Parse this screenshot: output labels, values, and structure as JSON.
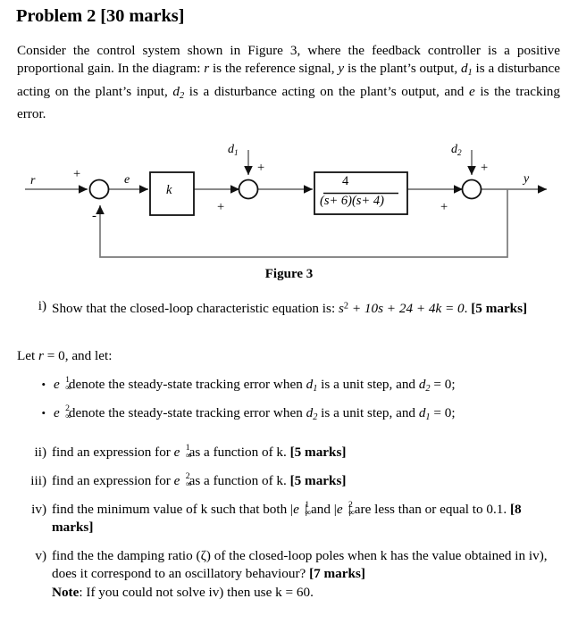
{
  "document": {
    "title": "Problem 2 [30 marks]",
    "intro": {
      "part1": "Consider the control system shown in Figure 3, where the feedback controller is a positive proportional gain.  In the diagram: ",
      "r": "r",
      "part2": " is the reference signal, ",
      "y": "y",
      "part3": " is the plant’s output, ",
      "d1": "d",
      "d1_sub": "1",
      "part4": " is a disturbance acting on the plant’s input, ",
      "d2": "d",
      "d2_sub": "2",
      "part5": " is a disturbance acting on the plant’s output, and ",
      "e": "e",
      "part6": " is the tracking error."
    },
    "figure": {
      "caption": "Figure 3",
      "labels": {
        "input": "r",
        "error": "e",
        "output": "y",
        "disturbance1": "d",
        "disturbance1_sub": "1",
        "disturbance2": "d",
        "disturbance2_sub": "2",
        "controller": "k",
        "plant_numerator": "4",
        "plant_denominator": "(s+ 6)(s+ 4)",
        "sign_plus": "+",
        "sign_minus": "-"
      }
    },
    "items": [
      {
        "marker": "i)",
        "text_before": "Show that the closed-loop characteristic equation is: ",
        "equation": "s",
        "equation_sup": "2",
        "equation_rest": " + 10s + 24 + 4k = 0",
        "text_after": ". ",
        "marks": "[5 marks]"
      },
      {
        "marker": "ii)",
        "text_before": "find an expression for ",
        "symbol_base": "e",
        "symbol_sup": "1",
        "symbol_sub": "∞",
        "text_after": " as a function of k. ",
        "marks": "[5 marks]"
      },
      {
        "marker": "iii)",
        "text_before": "find an expression for ",
        "symbol_base": "e",
        "symbol_sup": "2",
        "symbol_sub": "∞",
        "text_after": " as a function of k. ",
        "marks": "[5 marks]"
      },
      {
        "marker": "iv)",
        "text_before": "find the minimum value of k such that both ",
        "abs1_base": "e",
        "abs1_sup": "1",
        "abs1_sub": "∞",
        "text_mid": " and ",
        "abs2_base": "e",
        "abs2_sup": "2",
        "abs2_sub": "∞",
        "text_after": " are less than or equal to 0.1. ",
        "marks": "[8 marks]"
      },
      {
        "marker": "v)",
        "text_before": "find the the damping ratio (ζ) of the closed-loop poles when k has the value obtained in iv), does it correspond to an oscillatory behaviour? ",
        "marks": "[7 marks]",
        "note_label": "Note",
        "note_text": ": If you could not solve iv) then use k = 60."
      }
    ],
    "let_line": {
      "prefix": "Let ",
      "variable": "r",
      "equals": " = 0, and let:"
    },
    "bullets": [
      {
        "symbol_base": "e",
        "symbol_sup": "1",
        "symbol_sub": "∞",
        "text_before": " denote the steady-state tracking error when ",
        "d_base": "d",
        "d_sub": "1",
        "text_mid": " is a unit step, and ",
        "d2_base": "d",
        "d2_sub": "2",
        "text_after": " = 0;"
      },
      {
        "symbol_base": "e",
        "symbol_sup": "2",
        "symbol_sub": "∞",
        "text_before": " denote the steady-state tracking error when ",
        "d_base": "d",
        "d_sub": "2",
        "text_mid": " is a unit step, and ",
        "d2_base": "d",
        "d2_sub": "1",
        "text_after": " = 0;"
      }
    ],
    "colors": {
      "text": "#000000",
      "background": "#ffffff",
      "diagram_line": "#6b6b6b",
      "diagram_stroke": "#1a1a1a"
    }
  }
}
